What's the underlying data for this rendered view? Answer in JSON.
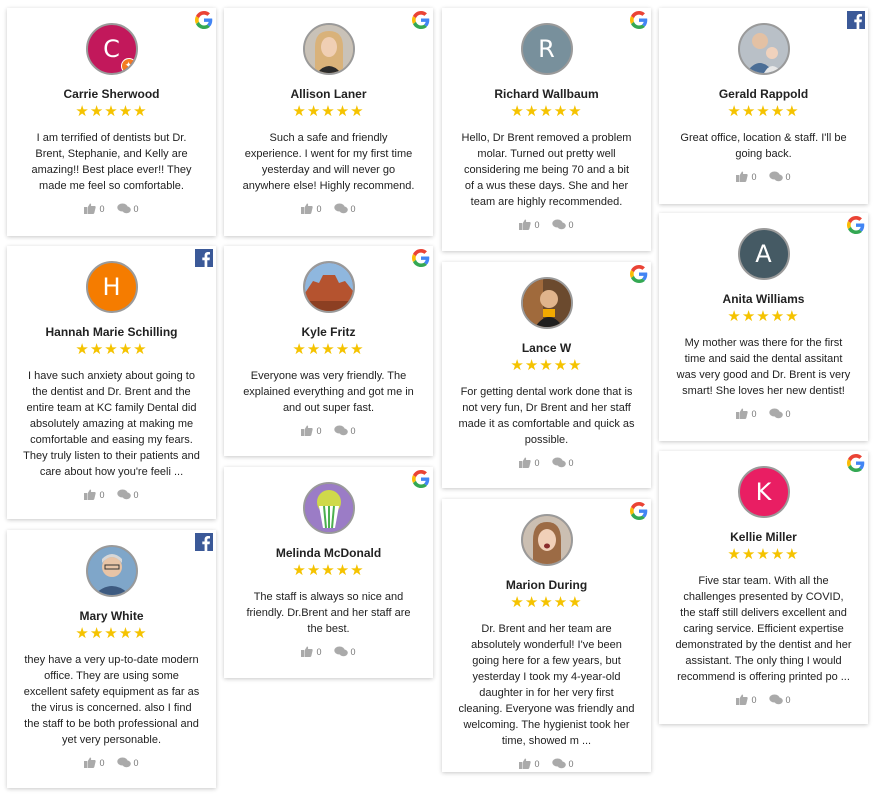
{
  "stars": "★★★★★",
  "reviews": [
    {
      "name": "Carrie Sherwood",
      "source": "google",
      "initial": "C",
      "avatar_color": "#c2185b",
      "text": "I am terrified of dentists but Dr. Brent, Stephanie, and Kelly are amazing!! Best place ever!! They made me feel so comfortable.",
      "likes": "0",
      "comments": "0"
    },
    {
      "name": "Hannah Marie Schilling",
      "source": "facebook",
      "initial": "H",
      "avatar_color": "#f57c00",
      "text": "I have such anxiety about going to the dentist and Dr. Brent and the entire team at KC family Dental did absolutely amazing at making me comfortable and easing my fears. They truly listen to their patients and care about how you're feeli ...",
      "likes": "0",
      "comments": "0"
    },
    {
      "name": "Mary White",
      "source": "facebook",
      "initial": "",
      "avatar_color": "#6b8fb3",
      "text": "they have a very up-to-date modern office. They are using some excellent safety equipment as far as the virus is concerned. also I find the staff to be both professional and yet very personable.",
      "likes": "0",
      "comments": "0"
    },
    {
      "name": "Allison Laner",
      "source": "google",
      "initial": "",
      "avatar_color": "#d9b98a",
      "text": "Such a safe and friendly experience. I went for my first time yesterday and will never go anywhere else! Highly recommend.",
      "likes": "0",
      "comments": "0"
    },
    {
      "name": "Kyle Fritz",
      "source": "google",
      "initial": "",
      "avatar_color": "#b5532f",
      "text": "Everyone was very friendly. The explained everything and got me in and out super fast.",
      "likes": "0",
      "comments": "0"
    },
    {
      "name": "Melinda McDonald",
      "source": "google",
      "initial": "",
      "avatar_color": "#8e6bb8",
      "text": "The staff is always so nice and friendly. Dr.Brent and her staff are the best.",
      "likes": "0",
      "comments": "0"
    },
    {
      "name": "Richard Wallbaum",
      "source": "google",
      "initial": "R",
      "avatar_color": "#78909c",
      "text": "Hello, Dr Brent removed a problem molar. Turned out pretty well considering me being 70 and a bit of a wus these days. She and her team are highly recommended.",
      "likes": "0",
      "comments": "0"
    },
    {
      "name": "Lance W",
      "source": "google",
      "initial": "",
      "avatar_color": "#8a5a3a",
      "text": "For getting dental work done that is not very fun, Dr Brent and her staff made it as comfortable and quick as possible.",
      "likes": "0",
      "comments": "0"
    },
    {
      "name": "Marion During",
      "source": "google",
      "initial": "",
      "avatar_color": "#b08a70",
      "text": "Dr. Brent and her team are absolutely wonderful! I've been going here for a few years, but yesterday I took my 4-year-old daughter in for her very first cleaning. Everyone was friendly and welcoming. The hygienist took her time, showed m ...",
      "likes": "0",
      "comments": "0"
    },
    {
      "name": "Gerald Rappold",
      "source": "facebook",
      "initial": "",
      "avatar_color": "#9aa3ab",
      "text": "Great office, location & staff. I'll be going back.",
      "likes": "0",
      "comments": "0"
    },
    {
      "name": "Anita Williams",
      "source": "google",
      "initial": "A",
      "avatar_color": "#455a64",
      "text": "My mother was there for the first time and said the dental assitant was very good and Dr. Brent is very smart! She loves her new dentist!",
      "likes": "0",
      "comments": "0"
    },
    {
      "name": "Kellie Miller",
      "source": "google",
      "initial": "K",
      "avatar_color": "#e91e63",
      "text": "Five star team. With all the challenges presented by COVID, the staff still delivers excellent and caring service. Efficient expertise demonstrated by the dentist and her assistant. The only thing I would recommend is offering printed po ...",
      "likes": "0",
      "comments": "0"
    }
  ]
}
